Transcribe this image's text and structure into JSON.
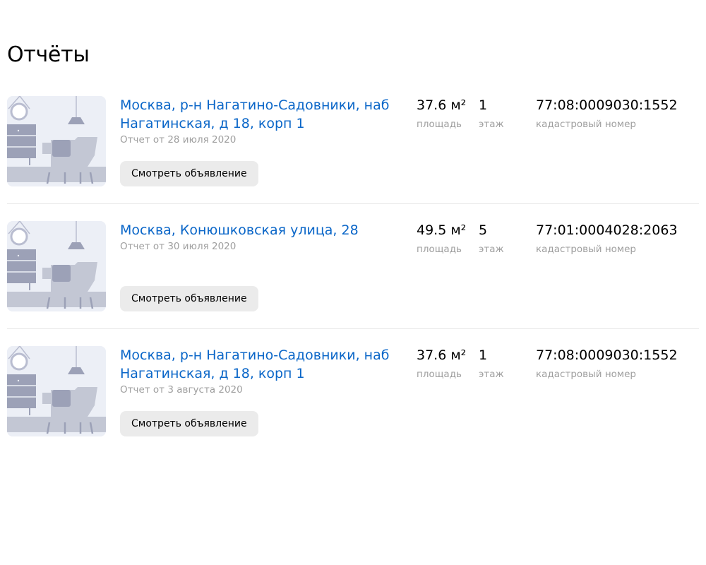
{
  "page": {
    "title": "Отчёты"
  },
  "labels": {
    "area": "площадь",
    "floor": "этаж",
    "cadastral": "кадастровый номер"
  },
  "reports": [
    {
      "address": "Москва, р-н Нагатино-Садовники, наб Нагатинская, д 18, корп 1",
      "date": "Отчет от 28 июля 2020",
      "button": "Смотреть объявление",
      "area": "37.6 м²",
      "floor": "1",
      "cadastral_number": "77:08:0009030:1552"
    },
    {
      "address": "Москва, Конюшковская улица, 28",
      "date": "Отчет от 30 июля 2020",
      "button": "Смотреть объявление",
      "area": "49.5 м²",
      "floor": "5",
      "cadastral_number": "77:01:0004028:2063"
    },
    {
      "address": "Москва, р-н Нагатино-Садовники, наб Нагатинская, д 18, корп 1",
      "date": "Отчет от 3 августа 2020",
      "button": "Смотреть объявление",
      "area": "37.6 м²",
      "floor": "1",
      "cadastral_number": "77:08:0009030:1552"
    }
  ]
}
